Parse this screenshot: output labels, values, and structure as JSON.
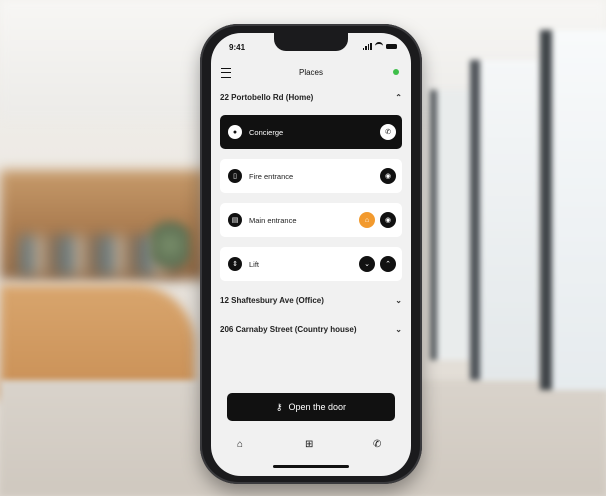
{
  "status": {
    "time": "9:41"
  },
  "header": {
    "title": "Places",
    "menu_icon": "menu-icon",
    "status_dot_color": "#3fbf4a"
  },
  "places": [
    {
      "name": "22 Portobello Rd (Home)",
      "expanded": true,
      "chevron": "⌃",
      "entrances": [
        {
          "label": "Concierge",
          "icon": "user-icon",
          "selected": true,
          "actions": [
            "phone-icon"
          ]
        },
        {
          "label": "Fire entrance",
          "icon": "door-icon",
          "selected": false,
          "actions": [
            "eye-icon"
          ]
        },
        {
          "label": "Main entrance",
          "icon": "gate-icon",
          "selected": false,
          "actions": [
            "lock-icon",
            "eye-icon"
          ]
        },
        {
          "label": "Lift",
          "icon": "lift-icon",
          "selected": false,
          "actions": [
            "chevron-down-icon",
            "chevron-up-icon"
          ]
        }
      ]
    },
    {
      "name": "12 Shaftesbury Ave (Office)",
      "expanded": false,
      "chevron": "⌄"
    },
    {
      "name": "206 Carnaby Street (Country house)",
      "expanded": false,
      "chevron": "⌄"
    }
  ],
  "open_button": {
    "label": "Open the door",
    "icon": "key-icon"
  },
  "tabbar": {
    "items": [
      "home-icon",
      "plus-square-icon",
      "phone-icon"
    ]
  },
  "colors": {
    "accent_orange": "#f29a2e",
    "dark": "#111111"
  }
}
